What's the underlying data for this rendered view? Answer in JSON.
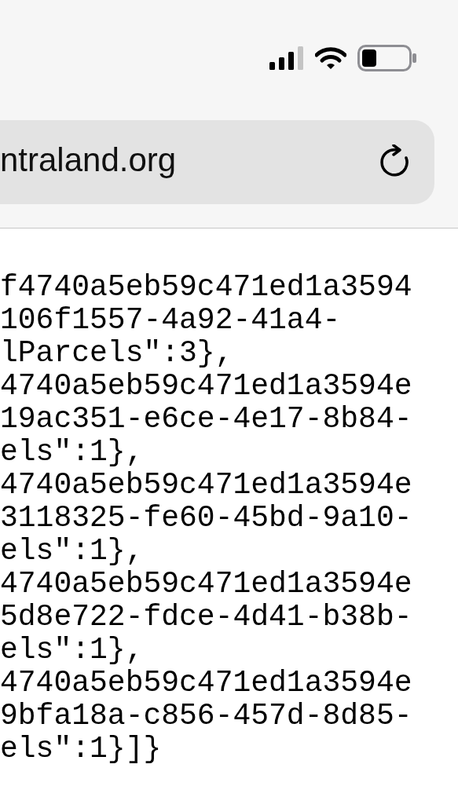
{
  "address_bar": {
    "url": "ntraland.org"
  },
  "page_text": [
    "f4740a5eb59c471ed1a3594",
    "106f1557-4a92-41a4-",
    "lParcels\":3},",
    "4740a5eb59c471ed1a3594e",
    "19ac351-e6ce-4e17-8b84-",
    "els\":1},",
    "4740a5eb59c471ed1a3594e",
    "3118325-fe60-45bd-9a10-",
    "els\":1},",
    "4740a5eb59c471ed1a3594e",
    "5d8e722-fdce-4d41-b38b-",
    "els\":1},",
    "4740a5eb59c471ed1a3594e",
    "9bfa18a-c856-457d-8d85-",
    "els\":1}]}"
  ]
}
